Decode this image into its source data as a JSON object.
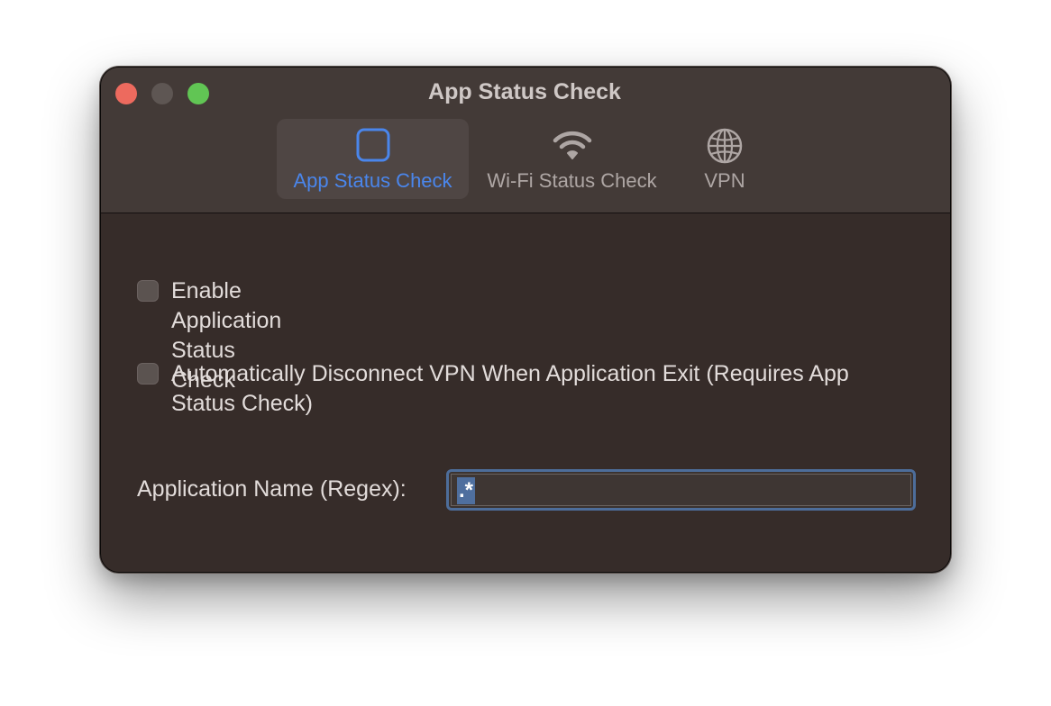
{
  "window": {
    "title": "App Status Check"
  },
  "toolbar": {
    "tabs": [
      {
        "label": "App Status Check",
        "icon": "square-icon",
        "active": true
      },
      {
        "label": "Wi-Fi Status Check",
        "icon": "wifi-icon",
        "active": false
      },
      {
        "label": "VPN",
        "icon": "globe-icon",
        "active": false
      }
    ]
  },
  "settings": {
    "enable_check": {
      "label": "Enable Application Status Check",
      "checked": false
    },
    "auto_disconnect": {
      "label_line1": "Automatically Disconnect VPN When Application Exit (Requires App",
      "label_line2": "Status Check)",
      "checked": false
    },
    "app_name": {
      "label": "Application Name (Regex):",
      "value": ".*"
    }
  },
  "colors": {
    "accent": "#4a86ec",
    "close": "#ed6a5e",
    "zoom": "#61c554"
  }
}
